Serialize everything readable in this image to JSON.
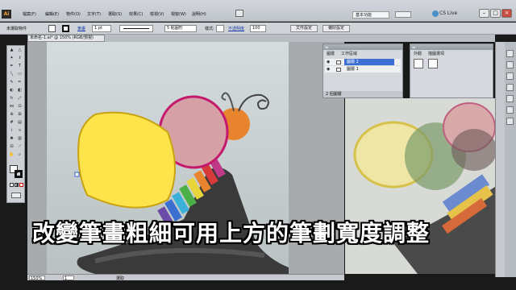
{
  "menubar": {
    "logo": "Ai",
    "items": [
      "檔案(F)",
      "編輯(E)",
      "物件(O)",
      "文字(T)",
      "選取(S)",
      "效果(C)",
      "檢視(V)",
      "視窗(W)",
      "說明(H)"
    ],
    "workspace": "基本功能",
    "cslive": "CS Live"
  },
  "control": {
    "selection_label": "未選取物件",
    "stroke_label": "筆畫",
    "stroke_width": "1 pt",
    "brush_label": "5 點圓形",
    "style_label": "樣式:",
    "opacity_label": "不透明度",
    "opacity_value": "100",
    "doc_setup": "文件設定",
    "prefs": "偏好設定"
  },
  "doc_tab": "未命名-1.ai* @ 150% (RGB/預視)",
  "layers_panel": {
    "tabs": [
      "圖層",
      "工作區域"
    ],
    "rows": [
      "圖層 2",
      "圖層 1"
    ],
    "footer": "2 個圖層"
  },
  "appearance_panel": {
    "tabs": [
      "外觀",
      "描圖選項"
    ]
  },
  "status": {
    "zoom": "150%",
    "page": "1",
    "mode": "選取"
  },
  "subtitle": "改變筆畫粗細可用上方的筆劃寬度調整",
  "colors": {
    "yellow_fill": "#fde44a",
    "magenta_stroke": "#c3196f",
    "pink_fill": "#d6a1a6",
    "orange": "#e8842e"
  }
}
